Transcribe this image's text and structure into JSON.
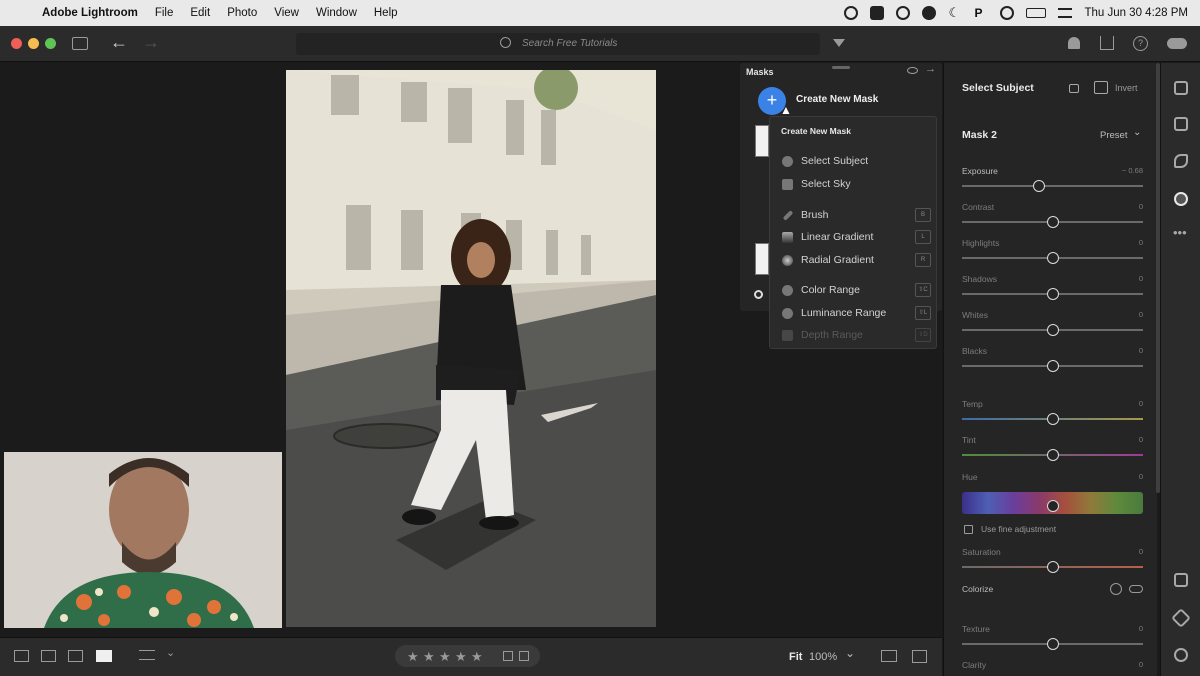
{
  "menubar": {
    "app_name": "Adobe Lightroom",
    "menus": [
      "File",
      "Edit",
      "Photo",
      "View",
      "Window",
      "Help"
    ],
    "clock": "Thu Jun 30  4:28 PM"
  },
  "toolbar": {
    "search_placeholder": "Search Free Tutorials"
  },
  "masks_panel": {
    "title": "Masks",
    "create_label": "Create New Mask",
    "dropdown_header": "Create New Mask",
    "items": [
      {
        "label": "Select Subject",
        "icon": "person-icon",
        "key": ""
      },
      {
        "label": "Select Sky",
        "icon": "sky-icon",
        "key": ""
      },
      {
        "label": "Brush",
        "icon": "brush-icon",
        "key": "B"
      },
      {
        "label": "Linear Gradient",
        "icon": "linear-gradient-icon",
        "key": "L"
      },
      {
        "label": "Radial Gradient",
        "icon": "radial-gradient-icon",
        "key": "R"
      },
      {
        "label": "Color Range",
        "icon": "color-range-icon",
        "key": "⇧C"
      },
      {
        "label": "Luminance Range",
        "icon": "luminance-range-icon",
        "key": "⇧L"
      },
      {
        "label": "Depth Range",
        "icon": "depth-range-icon",
        "key": "⇧D",
        "disabled": true
      }
    ]
  },
  "edit_panel": {
    "header": "Select Subject",
    "invert_label": "Invert",
    "mask_name": "Mask 2",
    "preset_label": "Preset",
    "sliders": [
      {
        "label": "Exposure",
        "value": "− 0.68",
        "level": -0.15
      },
      {
        "label": "Contrast",
        "value": "0",
        "level": 0
      },
      {
        "label": "Highlights",
        "value": "0",
        "level": 0
      },
      {
        "label": "Shadows",
        "value": "0",
        "level": 0
      },
      {
        "label": "Whites",
        "value": "0",
        "level": 0
      },
      {
        "label": "Blacks",
        "value": "0",
        "level": 0
      },
      {
        "label": "Temp",
        "value": "0",
        "level": 0
      },
      {
        "label": "Tint",
        "value": "0",
        "level": 0
      }
    ],
    "hue_label": "Hue",
    "hue_value": "0",
    "fine_adjust_label": "Use fine adjustment",
    "saturation_label": "Saturation",
    "saturation_value": "0",
    "colorize_label": "Colorize",
    "texture_label": "Texture",
    "texture_value": "0",
    "clarity_label": "Clarity",
    "clarity_value": "0"
  },
  "bottombar": {
    "fit_label": "Fit",
    "zoom_label": "100%"
  },
  "colors": {
    "accent": "#3b82e6"
  }
}
